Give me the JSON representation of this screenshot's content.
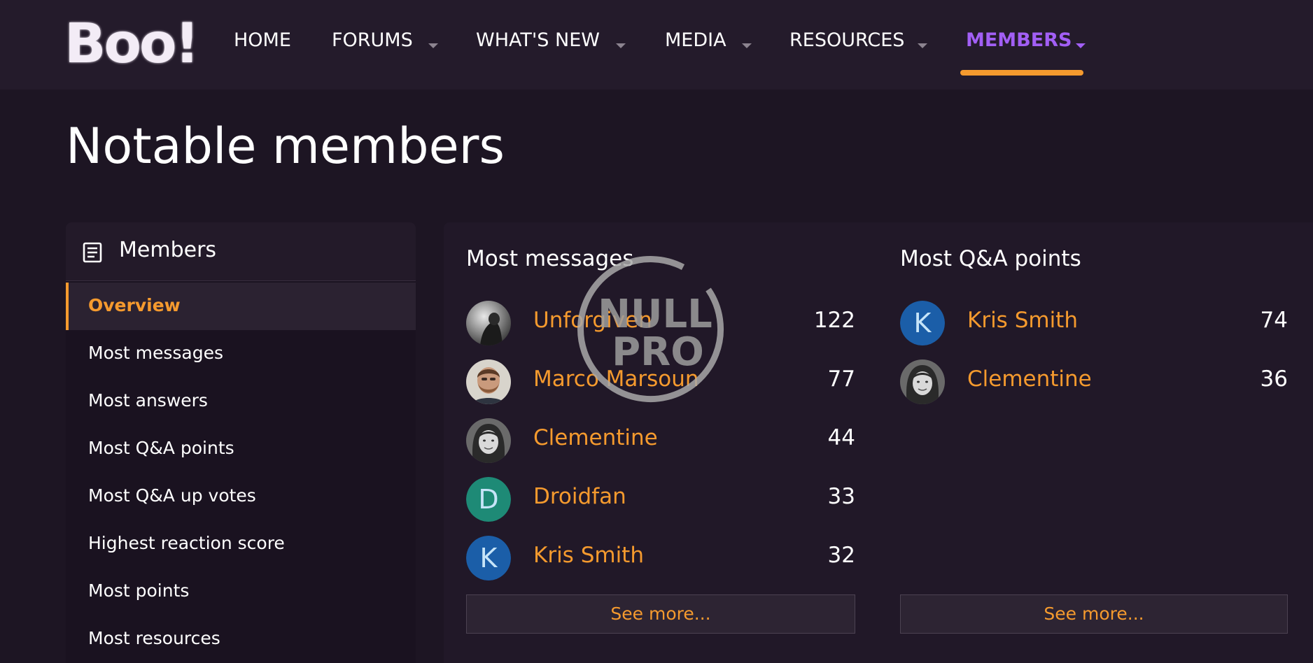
{
  "header": {
    "logo_text": "Boo!",
    "nav": [
      {
        "label": "HOME",
        "has_caret": false,
        "active": false
      },
      {
        "label": "FORUMS",
        "has_caret": true,
        "active": false
      },
      {
        "label": "WHAT'S NEW",
        "has_caret": true,
        "active": false
      },
      {
        "label": "MEDIA",
        "has_caret": true,
        "active": false
      },
      {
        "label": "RESOURCES",
        "has_caret": true,
        "active": false
      },
      {
        "label": "MEMBERS",
        "has_caret": true,
        "active": true
      }
    ]
  },
  "page": {
    "title": "Notable members"
  },
  "sidebar": {
    "title": "Members",
    "icon": "document-list-icon",
    "items": [
      {
        "label": "Overview",
        "active": true
      },
      {
        "label": "Most messages"
      },
      {
        "label": "Most answers"
      },
      {
        "label": "Most Q&A points"
      },
      {
        "label": "Most Q&A up votes"
      },
      {
        "label": "Highest reaction score"
      },
      {
        "label": "Most points"
      },
      {
        "label": "Most resources"
      }
    ]
  },
  "columns": [
    {
      "title": "Most messages",
      "members": [
        {
          "name": "Unforgiven",
          "count": "122",
          "avatar": "photo-dark-figure"
        },
        {
          "name": "Marco Marsoun",
          "count": "77",
          "avatar": "photo-bearded-man"
        },
        {
          "name": "Clementine",
          "count": "44",
          "avatar": "photo-woman-bw"
        },
        {
          "name": "Droidfan",
          "count": "33",
          "avatar": "letter",
          "letter": "D",
          "color": "#1e8a76"
        },
        {
          "name": "Kris Smith",
          "count": "32",
          "avatar": "letter",
          "letter": "K",
          "color": "#1b5ea8"
        }
      ],
      "see_more": "See more..."
    },
    {
      "title": "Most Q&A points",
      "members": [
        {
          "name": "Kris Smith",
          "count": "74",
          "avatar": "letter",
          "letter": "K",
          "color": "#1b5ea8"
        },
        {
          "name": "Clementine",
          "count": "36",
          "avatar": "photo-woman-bw"
        }
      ],
      "see_more": "See more..."
    }
  ],
  "watermark": {
    "line1": "NULL",
    "line2": "PRO"
  },
  "colors": {
    "accent": "#f59a2e",
    "active_nav": "#a25ff5",
    "background": "#1d1523"
  }
}
